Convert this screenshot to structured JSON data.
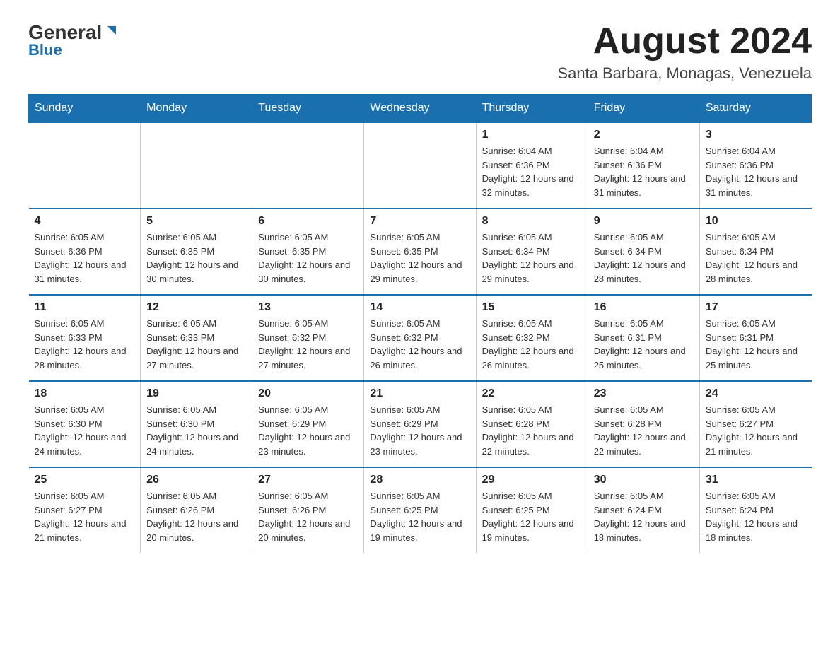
{
  "logo": {
    "text_general": "General",
    "text_blue": "Blue"
  },
  "header": {
    "month_title": "August 2024",
    "location": "Santa Barbara, Monagas, Venezuela"
  },
  "days_of_week": [
    "Sunday",
    "Monday",
    "Tuesday",
    "Wednesday",
    "Thursday",
    "Friday",
    "Saturday"
  ],
  "weeks": [
    {
      "days": [
        {
          "number": "",
          "info": ""
        },
        {
          "number": "",
          "info": ""
        },
        {
          "number": "",
          "info": ""
        },
        {
          "number": "",
          "info": ""
        },
        {
          "number": "1",
          "info": "Sunrise: 6:04 AM\nSunset: 6:36 PM\nDaylight: 12 hours and 32 minutes."
        },
        {
          "number": "2",
          "info": "Sunrise: 6:04 AM\nSunset: 6:36 PM\nDaylight: 12 hours and 31 minutes."
        },
        {
          "number": "3",
          "info": "Sunrise: 6:04 AM\nSunset: 6:36 PM\nDaylight: 12 hours and 31 minutes."
        }
      ]
    },
    {
      "days": [
        {
          "number": "4",
          "info": "Sunrise: 6:05 AM\nSunset: 6:36 PM\nDaylight: 12 hours and 31 minutes."
        },
        {
          "number": "5",
          "info": "Sunrise: 6:05 AM\nSunset: 6:35 PM\nDaylight: 12 hours and 30 minutes."
        },
        {
          "number": "6",
          "info": "Sunrise: 6:05 AM\nSunset: 6:35 PM\nDaylight: 12 hours and 30 minutes."
        },
        {
          "number": "7",
          "info": "Sunrise: 6:05 AM\nSunset: 6:35 PM\nDaylight: 12 hours and 29 minutes."
        },
        {
          "number": "8",
          "info": "Sunrise: 6:05 AM\nSunset: 6:34 PM\nDaylight: 12 hours and 29 minutes."
        },
        {
          "number": "9",
          "info": "Sunrise: 6:05 AM\nSunset: 6:34 PM\nDaylight: 12 hours and 28 minutes."
        },
        {
          "number": "10",
          "info": "Sunrise: 6:05 AM\nSunset: 6:34 PM\nDaylight: 12 hours and 28 minutes."
        }
      ]
    },
    {
      "days": [
        {
          "number": "11",
          "info": "Sunrise: 6:05 AM\nSunset: 6:33 PM\nDaylight: 12 hours and 28 minutes."
        },
        {
          "number": "12",
          "info": "Sunrise: 6:05 AM\nSunset: 6:33 PM\nDaylight: 12 hours and 27 minutes."
        },
        {
          "number": "13",
          "info": "Sunrise: 6:05 AM\nSunset: 6:32 PM\nDaylight: 12 hours and 27 minutes."
        },
        {
          "number": "14",
          "info": "Sunrise: 6:05 AM\nSunset: 6:32 PM\nDaylight: 12 hours and 26 minutes."
        },
        {
          "number": "15",
          "info": "Sunrise: 6:05 AM\nSunset: 6:32 PM\nDaylight: 12 hours and 26 minutes."
        },
        {
          "number": "16",
          "info": "Sunrise: 6:05 AM\nSunset: 6:31 PM\nDaylight: 12 hours and 25 minutes."
        },
        {
          "number": "17",
          "info": "Sunrise: 6:05 AM\nSunset: 6:31 PM\nDaylight: 12 hours and 25 minutes."
        }
      ]
    },
    {
      "days": [
        {
          "number": "18",
          "info": "Sunrise: 6:05 AM\nSunset: 6:30 PM\nDaylight: 12 hours and 24 minutes."
        },
        {
          "number": "19",
          "info": "Sunrise: 6:05 AM\nSunset: 6:30 PM\nDaylight: 12 hours and 24 minutes."
        },
        {
          "number": "20",
          "info": "Sunrise: 6:05 AM\nSunset: 6:29 PM\nDaylight: 12 hours and 23 minutes."
        },
        {
          "number": "21",
          "info": "Sunrise: 6:05 AM\nSunset: 6:29 PM\nDaylight: 12 hours and 23 minutes."
        },
        {
          "number": "22",
          "info": "Sunrise: 6:05 AM\nSunset: 6:28 PM\nDaylight: 12 hours and 22 minutes."
        },
        {
          "number": "23",
          "info": "Sunrise: 6:05 AM\nSunset: 6:28 PM\nDaylight: 12 hours and 22 minutes."
        },
        {
          "number": "24",
          "info": "Sunrise: 6:05 AM\nSunset: 6:27 PM\nDaylight: 12 hours and 21 minutes."
        }
      ]
    },
    {
      "days": [
        {
          "number": "25",
          "info": "Sunrise: 6:05 AM\nSunset: 6:27 PM\nDaylight: 12 hours and 21 minutes."
        },
        {
          "number": "26",
          "info": "Sunrise: 6:05 AM\nSunset: 6:26 PM\nDaylight: 12 hours and 20 minutes."
        },
        {
          "number": "27",
          "info": "Sunrise: 6:05 AM\nSunset: 6:26 PM\nDaylight: 12 hours and 20 minutes."
        },
        {
          "number": "28",
          "info": "Sunrise: 6:05 AM\nSunset: 6:25 PM\nDaylight: 12 hours and 19 minutes."
        },
        {
          "number": "29",
          "info": "Sunrise: 6:05 AM\nSunset: 6:25 PM\nDaylight: 12 hours and 19 minutes."
        },
        {
          "number": "30",
          "info": "Sunrise: 6:05 AM\nSunset: 6:24 PM\nDaylight: 12 hours and 18 minutes."
        },
        {
          "number": "31",
          "info": "Sunrise: 6:05 AM\nSunset: 6:24 PM\nDaylight: 12 hours and 18 minutes."
        }
      ]
    }
  ]
}
